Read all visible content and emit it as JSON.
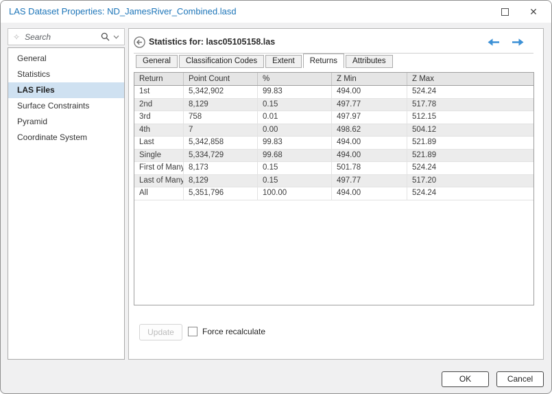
{
  "window": {
    "title": "LAS Dataset Properties: ND_JamesRiver_Combined.lasd",
    "title_color": "#1b74b8",
    "close_glyph": "✕"
  },
  "sidebar": {
    "search": {
      "placeholder": "Search",
      "sparkle_glyph": "✧"
    },
    "items": [
      {
        "label": "General",
        "selected": false
      },
      {
        "label": "Statistics",
        "selected": false
      },
      {
        "label": "LAS Files",
        "selected": true
      },
      {
        "label": "Surface Constraints",
        "selected": false
      },
      {
        "label": "Pyramid",
        "selected": false
      },
      {
        "label": "Coordinate System",
        "selected": false
      }
    ],
    "selected_bg": "#cfe1f1"
  },
  "panel": {
    "header": {
      "title": "Statistics for: lasc05105158.las"
    },
    "nav_arrow_color": "#3d91d6",
    "tabs": [
      {
        "label": "General",
        "active": false
      },
      {
        "label": "Classification Codes",
        "active": false
      },
      {
        "label": "Extent",
        "active": false
      },
      {
        "label": "Returns",
        "active": true
      },
      {
        "label": "Attributes",
        "active": false
      }
    ],
    "table": {
      "columns": [
        "Return",
        "Point Count",
        "%",
        "Z Min",
        "Z Max"
      ],
      "rows": [
        [
          "1st",
          "5,342,902",
          "99.83",
          "494.00",
          "524.24"
        ],
        [
          "2nd",
          "8,129",
          "0.15",
          "497.77",
          "517.78"
        ],
        [
          "3rd",
          "758",
          "0.01",
          "497.97",
          "512.15"
        ],
        [
          "4th",
          "7",
          "0.00",
          "498.62",
          "504.12"
        ],
        [
          "Last",
          "5,342,858",
          "99.83",
          "494.00",
          "521.89"
        ],
        [
          "Single",
          "5,334,729",
          "99.68",
          "494.00",
          "521.89"
        ],
        [
          "First of Many",
          "8,173",
          "0.15",
          "501.78",
          "524.24"
        ],
        [
          "Last of Many",
          "8,129",
          "0.15",
          "497.77",
          "517.20"
        ],
        [
          "All",
          "5,351,796",
          "100.00",
          "494.00",
          "524.24"
        ]
      ],
      "alt_row_bg": "#ececec"
    },
    "update_label": "Update",
    "update_disabled": true,
    "force_recalculate_label": "Force recalculate",
    "force_recalculate_checked": false
  },
  "footer": {
    "ok_label": "OK",
    "cancel_label": "Cancel"
  }
}
